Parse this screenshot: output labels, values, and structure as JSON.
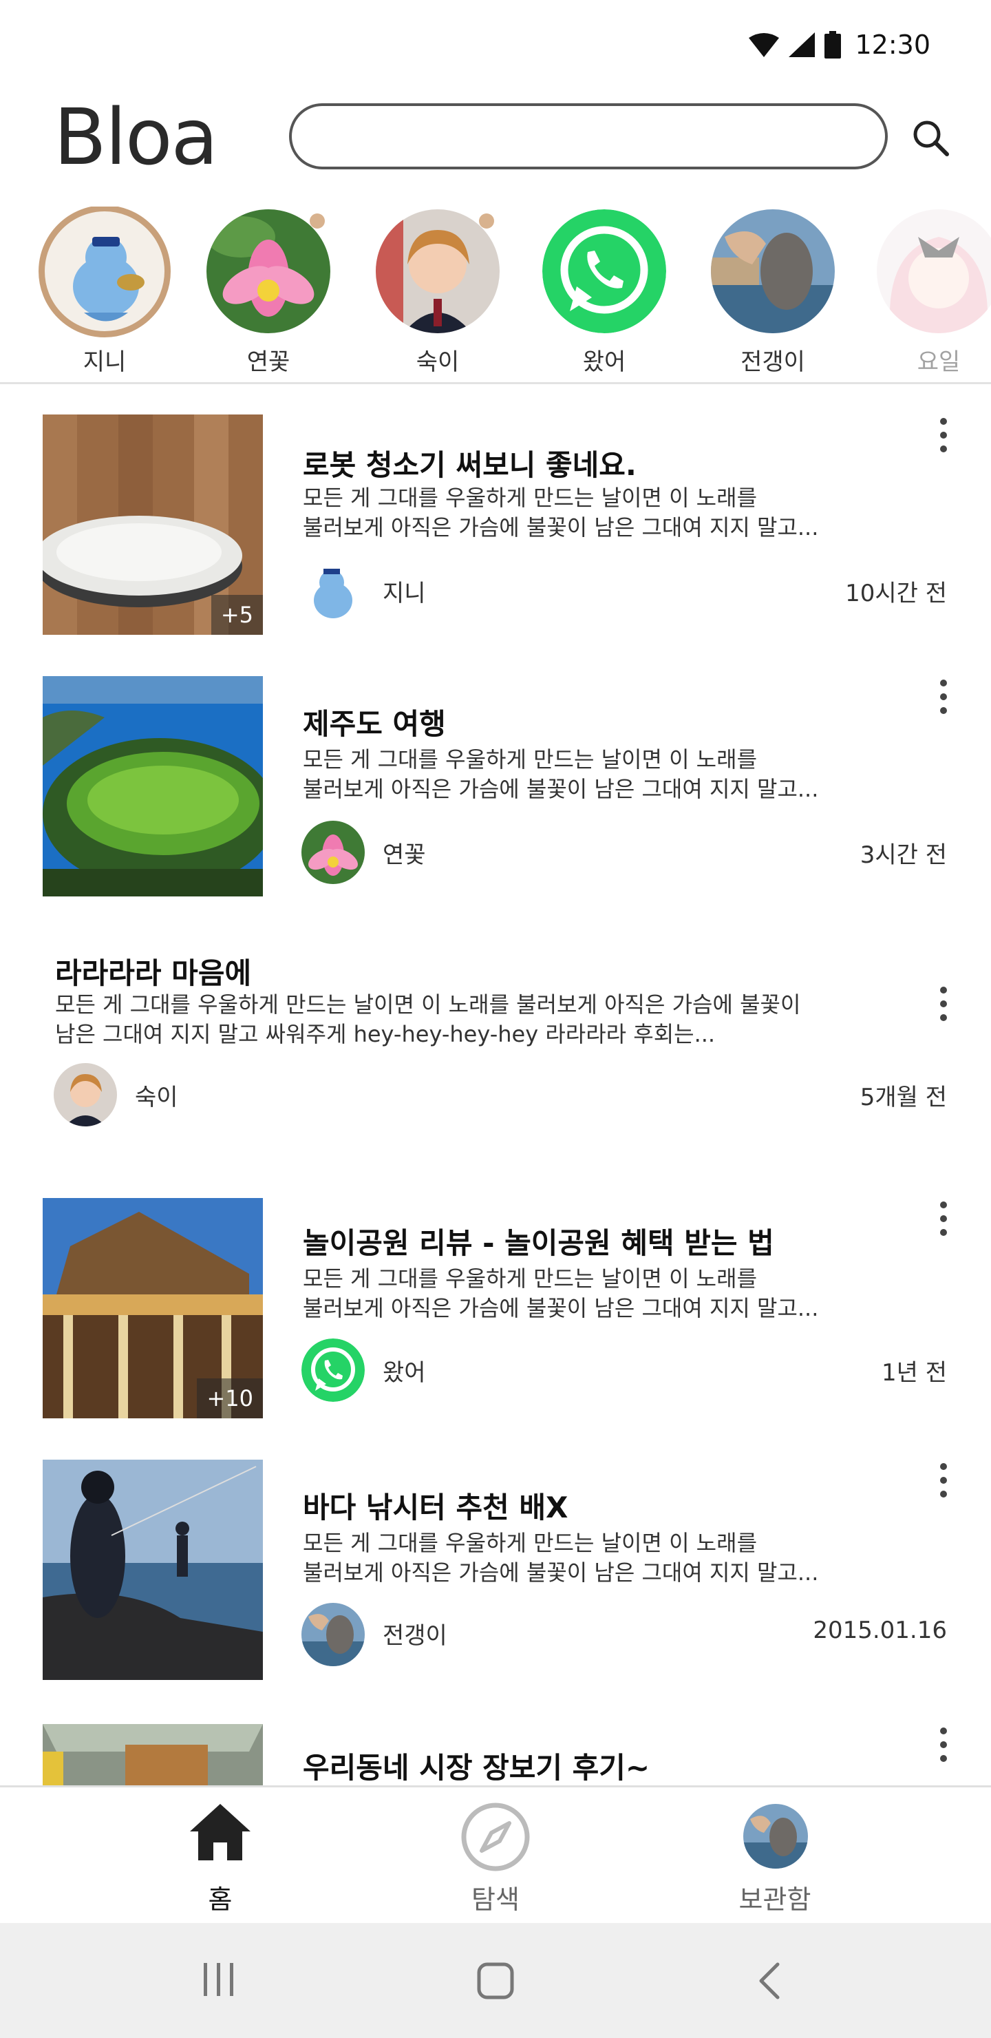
{
  "status": {
    "time": "12:30"
  },
  "header": {
    "logo": "Bloa",
    "search": {
      "value": "",
      "placeholder": ""
    }
  },
  "stories": [
    {
      "name": "지니"
    },
    {
      "name": "연꽃"
    },
    {
      "name": "숙이"
    },
    {
      "name": "왔어"
    },
    {
      "name": "전갱이"
    },
    {
      "name": "요일"
    }
  ],
  "posts": [
    {
      "title": "로봇 청소기 써보니 좋네요.",
      "desc": "모든 게 그대를 우울하게 만드는 날이면 이 노래를\n불러보게 아직은 가슴에 불꽃이 남은 그대여 지지 말고...",
      "author": "지니",
      "time": "10시간 전",
      "badge": "+5"
    },
    {
      "title": "제주도 여행",
      "desc": "모든 게 그대를 우울하게 만드는 날이면 이 노래를\n불러보게 아직은 가슴에 불꽃이 남은 그대여 지지 말고...",
      "author": "연꽃",
      "time": "3시간 전"
    },
    {
      "title": "라라라라 마음에",
      "desc": "모든 게 그대를 우울하게 만드는 날이면 이 노래를 불러보게 아직은 가슴에 불꽃이\n남은 그대여 지지 말고 싸워주게 hey-hey-hey-hey 라라라라 후회는...",
      "author": "숙이",
      "time": "5개월 전"
    },
    {
      "title": "놀이공원 리뷰 - 놀이공원 혜택 받는 법",
      "desc": "모든 게 그대를 우울하게 만드는 날이면 이 노래를\n불러보게 아직은 가슴에 불꽃이 남은 그대여 지지 말고...",
      "author": "왔어",
      "time": "1년 전",
      "badge": "+10"
    },
    {
      "title": "바다 낚시터 추천 배X",
      "desc": "모든 게 그대를 우울하게 만드는 날이면 이 노래를\n불러보게 아직은 가슴에 불꽃이 남은 그대여 지지 말고...",
      "author": "전갱이",
      "time": "2015.01.16"
    },
    {
      "title": "우리동네 시장 장보기 후기~"
    }
  ],
  "nav": {
    "home": "홈",
    "explore": "탐색",
    "library": "보관함"
  },
  "colors": {
    "story_ring": "#c8a07a",
    "whatsapp": "#25d366",
    "active_nav": "#111111"
  },
  "icons": {
    "status": [
      "wifi-icon",
      "signal-icon",
      "battery-icon"
    ],
    "search": "search-icon",
    "nav": [
      "home-icon",
      "compass-icon",
      "profile-avatar"
    ],
    "system": [
      "recent-apps-icon",
      "home-button-icon",
      "back-icon"
    ]
  }
}
